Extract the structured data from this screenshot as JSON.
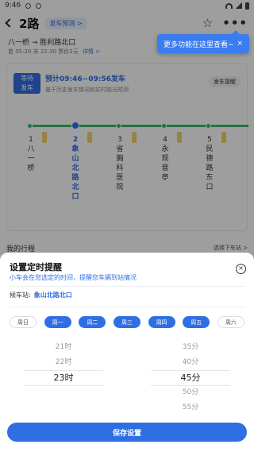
{
  "status": {
    "time": "9:46"
  },
  "header": {
    "route": "2路",
    "forecast_chip": "发车预测 >",
    "star_icon": "☆",
    "more_icon": "•••"
  },
  "direction": {
    "text": "八一桥 → 胜利路北口",
    "times": "首 05:20 末 22:30 票价2元",
    "detail": "详情 >"
  },
  "tooltip": {
    "text": "更多功能在这里查看~",
    "close": "×"
  },
  "wait": {
    "box_line1": "等待",
    "box_line2": "发车",
    "title": "预计09:46~09:56发车",
    "subtitle": "基于历史发车情况和实时路况预测",
    "remind": "发车提醒"
  },
  "stops": [
    {
      "name": "1八一桥",
      "current": false
    },
    {
      "name": "2象山北路北口",
      "current": true
    },
    {
      "name": "3省胸科医院",
      "current": false
    },
    {
      "name": "4永观音亭",
      "current": false
    },
    {
      "name": "5民德路东口",
      "current": false
    }
  ],
  "trip": {
    "title": "我的行程",
    "get_off": "选择下车站 >"
  },
  "sheet": {
    "title": "设置定时提醒",
    "subtitle": "小车会在您选定的时间，提醒您车辆到站情况",
    "close": "×",
    "stop_label": "候车站:",
    "stop_value": "象山北路北口",
    "days": [
      {
        "label": "周日",
        "on": false
      },
      {
        "label": "周一",
        "on": true
      },
      {
        "label": "周二",
        "on": true
      },
      {
        "label": "周三",
        "on": true
      },
      {
        "label": "周四",
        "on": true
      },
      {
        "label": "周五",
        "on": true
      },
      {
        "label": "周六",
        "on": false
      }
    ],
    "hours": [
      "21时",
      "22时",
      "23时"
    ],
    "minutes": [
      "35分",
      "40分",
      "45分",
      "50分",
      "55分"
    ],
    "selected_hour": "23时",
    "selected_minute": "45分",
    "save": "保存设置"
  }
}
